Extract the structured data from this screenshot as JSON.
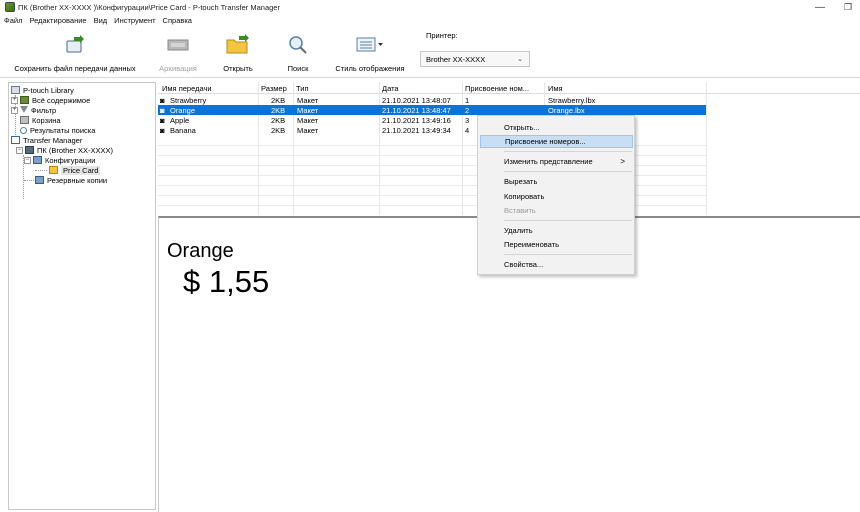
{
  "window": {
    "title": "ПК (Brother XX-XXXX )\\Конфигурации\\Price Card - P-touch Transfer Manager",
    "minimize": "—",
    "maximize": "❐",
    "close": "✕"
  },
  "menu": [
    "Файл",
    "Редактирование",
    "Вид",
    "Инструмент",
    "Справка"
  ],
  "toolbar": {
    "save_label": "Сохранить файл передачи данных",
    "archive_label": "Архивация",
    "open_label": "Открыть",
    "search_label": "Поиск",
    "style_label": "Стиль отображения",
    "printer_label": "Принтер:",
    "printer_value": "Brother XX-XXXX"
  },
  "tree": {
    "library": "P-touch Library",
    "all_content": "Всё содержимое",
    "filter": "Фильтр",
    "trash": "Корзина",
    "search_results": "Результаты поиска",
    "transfer_manager": "Transfer Manager",
    "pc": "ПК (Brother XX-XXXX)",
    "configurations": "Конфигурации",
    "price_card": "Price Card",
    "backups": "Резервные копии"
  },
  "list": {
    "columns": [
      "Имя передачи",
      "Размер",
      "Тип",
      "Дата",
      "Присвоение ном...",
      "Имя"
    ],
    "rows": [
      {
        "name": "Strawberry",
        "size": "2KB",
        "type": "Макет",
        "date": "21.10.2021 13:48:07",
        "num": "1",
        "file": "Strawberry.lbx"
      },
      {
        "name": "Orange",
        "size": "2KB",
        "type": "Макет",
        "date": "21.10.2021 13:48:47",
        "num": "2",
        "file": "Orange.lbx"
      },
      {
        "name": "Apple",
        "size": "2KB",
        "type": "Макет",
        "date": "21.10.2021 13:49:16",
        "num": "3",
        "file": ""
      },
      {
        "name": "Banana",
        "size": "2KB",
        "type": "Макет",
        "date": "21.10.2021 13:49:34",
        "num": "4",
        "file": ""
      }
    ]
  },
  "preview": {
    "name": "Orange",
    "price": "$ 1,55"
  },
  "context_menu": {
    "open": "Открыть...",
    "assign": "Присвоение номеров...",
    "change_view": "Изменить представление",
    "cut": "Вырезать",
    "copy": "Копировать",
    "paste": "Вставить",
    "delete": "Удалить",
    "rename": "Переименовать",
    "properties": "Свойства...",
    "submenu_arrow": ">"
  },
  "colors": {
    "selection": "#0a74da",
    "menu_highlight": "#c8def5"
  }
}
